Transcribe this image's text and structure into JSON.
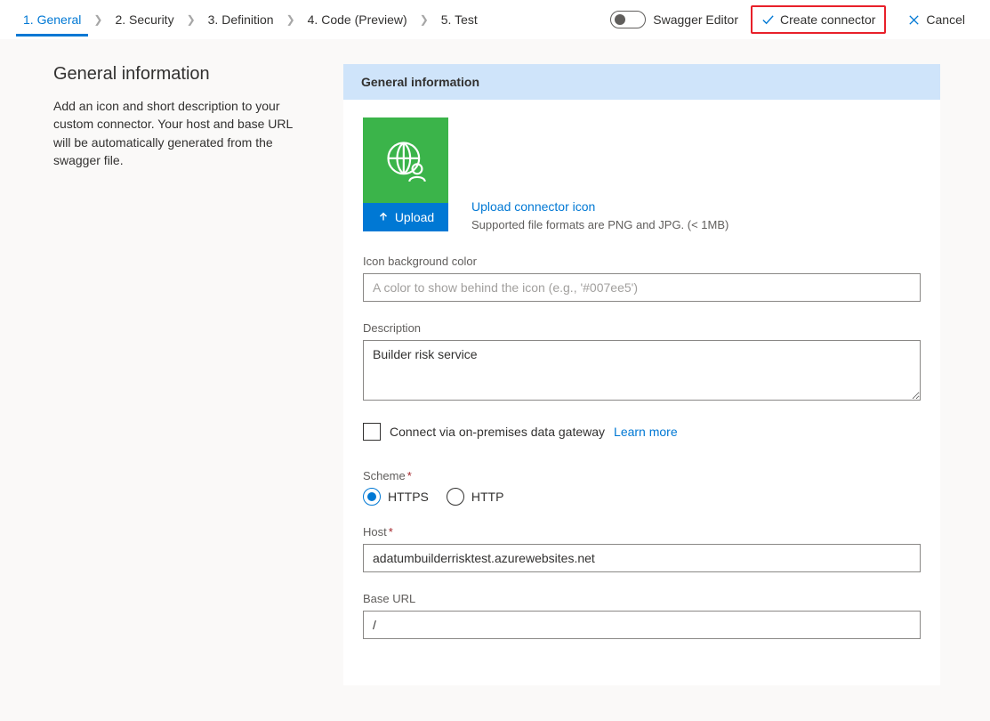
{
  "tabs": {
    "t1": "1. General",
    "t2": "2. Security",
    "t3": "3. Definition",
    "t4": "4. Code (Preview)",
    "t5": "5. Test"
  },
  "topbar": {
    "swagger_toggle_label": "Swagger Editor",
    "create_label": "Create connector",
    "cancel_label": "Cancel"
  },
  "sidebar": {
    "title": "General information",
    "desc": "Add an icon and short description to your custom connector. Your host and base URL will be automatically generated from the swagger file."
  },
  "panel": {
    "title": "General information",
    "upload_button": "Upload",
    "upload_link": "Upload connector icon",
    "upload_hint": "Supported file formats are PNG and JPG. (< 1MB)",
    "fields": {
      "icon_bg": {
        "label": "Icon background color",
        "placeholder": "A color to show behind the icon (e.g., '#007ee5')",
        "value": ""
      },
      "description": {
        "label": "Description",
        "value": "Builder risk service"
      },
      "gateway": {
        "label": "Connect via on-premises data gateway",
        "learn_more": "Learn more"
      },
      "scheme": {
        "label": "Scheme",
        "opt_https": "HTTPS",
        "opt_http": "HTTP",
        "selected": "HTTPS"
      },
      "host": {
        "label": "Host",
        "value": "adatumbuilderrisktest.azurewebsites.net"
      },
      "base_url": {
        "label": "Base URL",
        "value": "/"
      }
    }
  }
}
